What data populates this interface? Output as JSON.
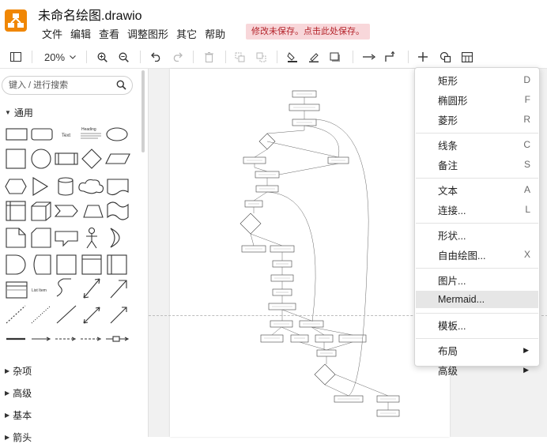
{
  "app": {
    "title": "未命名绘图.drawio",
    "unsaved_notice": "修改未保存。点击此处保存。",
    "accent": "#f08705"
  },
  "menubar": [
    "文件",
    "编辑",
    "查看",
    "调整图形",
    "其它",
    "帮助"
  ],
  "toolbar": {
    "zoom_label": "20%"
  },
  "sidebar": {
    "search_placeholder": "键入 / 进行搜索",
    "general_section": "通用",
    "shape_text_label": "Text",
    "shape_heading_label": "Heading",
    "shape_list_label": "List Item",
    "collapsed_sections": [
      "杂项",
      "高级",
      "基本",
      "箭头"
    ]
  },
  "context_menu": [
    {
      "label": "矩形",
      "key": "D"
    },
    {
      "label": "椭圆形",
      "key": "F"
    },
    {
      "label": "菱形",
      "key": "R"
    },
    {
      "sep": true
    },
    {
      "label": "线条",
      "key": "C"
    },
    {
      "label": "备注",
      "key": "S"
    },
    {
      "sep": true
    },
    {
      "label": "文本",
      "key": "A"
    },
    {
      "label": "连接...",
      "key": "L"
    },
    {
      "sep": true
    },
    {
      "label": "形状...",
      "key": ""
    },
    {
      "label": "自由绘图...",
      "key": "X"
    },
    {
      "sep": true
    },
    {
      "label": "图片...",
      "key": ""
    },
    {
      "label": "Mermaid...",
      "key": "",
      "highlighted": true
    },
    {
      "sep": true
    },
    {
      "label": "模板...",
      "key": ""
    },
    {
      "sep": true
    },
    {
      "label": "布局",
      "key": "",
      "submenu": true
    },
    {
      "label": "高级",
      "key": "",
      "submenu": true
    }
  ]
}
